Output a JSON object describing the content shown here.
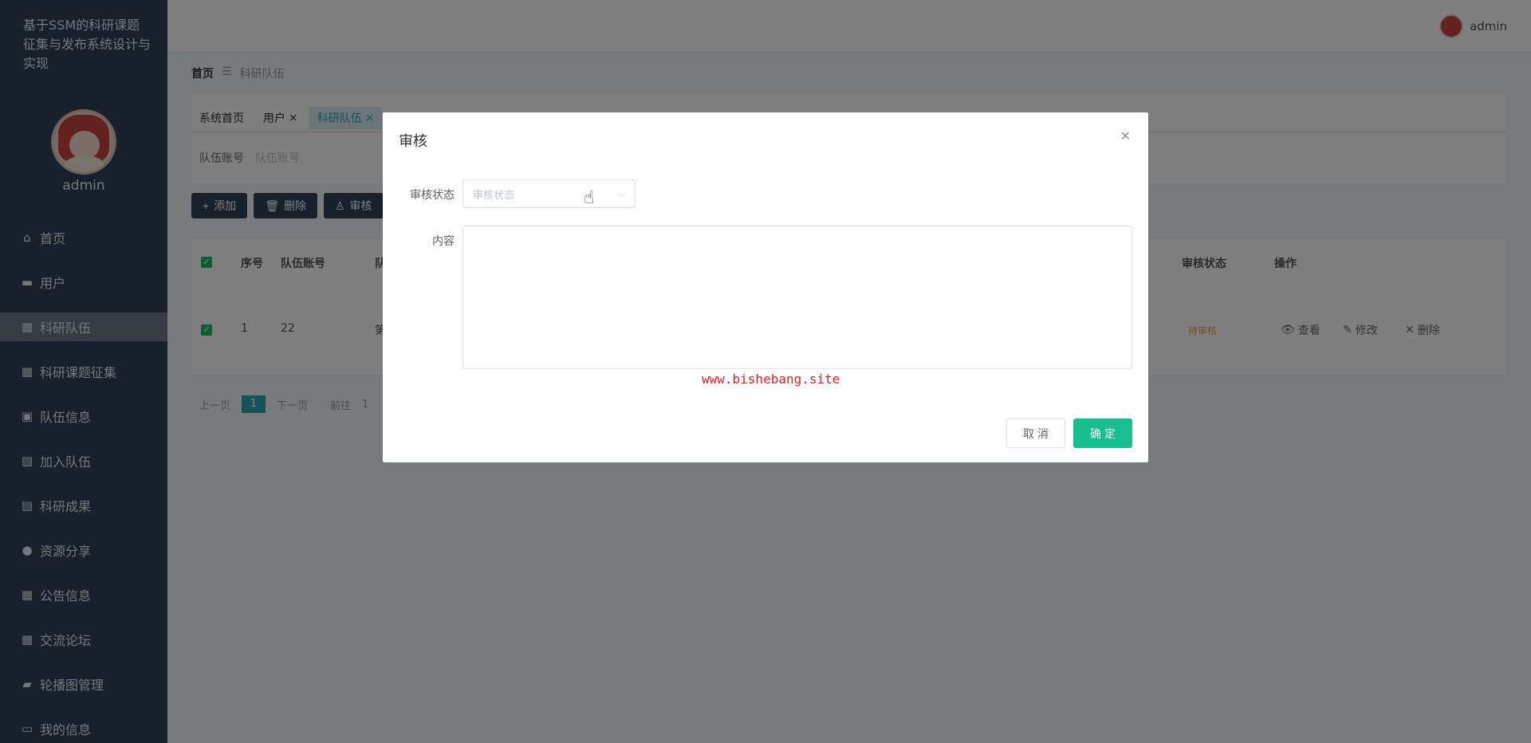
{
  "sidebar": {
    "title": "基于SSM的科研课题征集与发布系统设计与实现",
    "username": "admin",
    "items": [
      {
        "label": "首页",
        "icon": "home-icon",
        "glyph": "⌂"
      },
      {
        "label": "用户",
        "icon": "monitor-icon",
        "glyph": "▬"
      },
      {
        "label": "科研队伍",
        "icon": "grid-icon",
        "glyph": "▦",
        "active": true
      },
      {
        "label": "科研课题征集",
        "icon": "grid-icon",
        "glyph": "▦"
      },
      {
        "label": "队伍信息",
        "icon": "wallet-icon",
        "glyph": "▣"
      },
      {
        "label": "加入队伍",
        "icon": "clipboard-x-icon",
        "glyph": "▧"
      },
      {
        "label": "科研成果",
        "icon": "chat-icon",
        "glyph": "▤"
      },
      {
        "label": "资源分享",
        "icon": "user-icon",
        "glyph": "●"
      },
      {
        "label": "公告信息",
        "icon": "grid-icon",
        "glyph": "▦"
      },
      {
        "label": "交流论坛",
        "icon": "grid-icon",
        "glyph": "▦"
      },
      {
        "label": "轮播图管理",
        "icon": "ticket-icon",
        "glyph": "▰"
      },
      {
        "label": "我的信息",
        "icon": "card-icon",
        "glyph": "▭"
      }
    ]
  },
  "topbar": {
    "username": "admin"
  },
  "breadcrumb": {
    "home": "首页",
    "separator": "☰",
    "current": "科研队伍"
  },
  "tabs": [
    {
      "label": "系统首页",
      "closable": false
    },
    {
      "label": "用户",
      "closable": true
    },
    {
      "label": "科研队伍",
      "closable": true,
      "active": true
    }
  ],
  "search": {
    "label": "队伍账号",
    "placeholder": "队伍账号"
  },
  "buttons": {
    "add": "添加",
    "delete": "删除",
    "audit": "审核"
  },
  "table": {
    "headers": {
      "index": "序号",
      "account": "队伍账号",
      "col3": "队",
      "status": "审核状态",
      "ops": "操作"
    },
    "row": {
      "index": "1",
      "account": "22",
      "col3": "第",
      "status": "待审核",
      "view": "查看",
      "edit": "修改",
      "delete": "删除"
    }
  },
  "pager": {
    "prev": "上一页",
    "current": "1",
    "next": "下一页",
    "goto": "前往",
    "goto_tail": "1"
  },
  "dialog": {
    "title": "审核",
    "status_label": "审核状态",
    "status_placeholder": "审核状态",
    "content_label": "内容",
    "watermark": "www.bishebang.site",
    "cancel": "取 消",
    "ok": "确 定"
  },
  "colors": {
    "sidebar": "#304156",
    "accent": "#19be8f",
    "tab_active": "#2aa6b0"
  }
}
